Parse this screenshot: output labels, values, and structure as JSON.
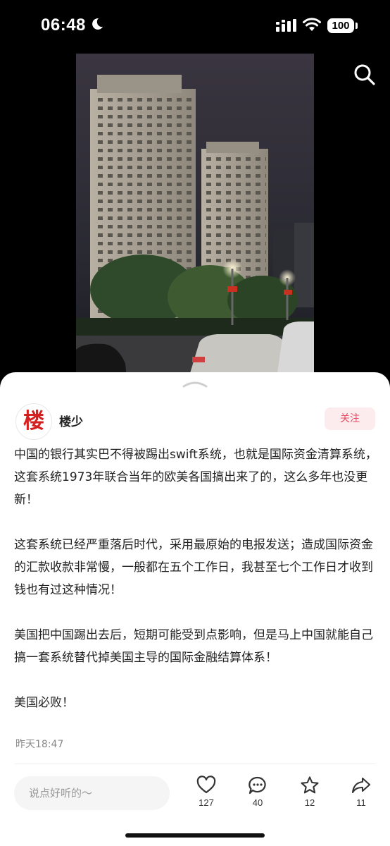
{
  "status_bar": {
    "time": "06:48",
    "battery": "100"
  },
  "post": {
    "author": {
      "avatar_char": "楼",
      "name": "楼少",
      "follow_label": "关注"
    },
    "paragraphs": [
      "中国的银行其实巴不得被踢出swift系统，也就是国际资金清算系统，这套系统1973年联合当年的欧美各国搞出来了的，这么多年也没更新！",
      "这套系统已经严重落后时代，采用最原始的电报发送；造成国际资金的汇款收款非常慢，一般都在五个工作日，我甚至七个工作日才收到钱也有过这种情况！",
      "美国把中国踢出去后，短期可能受到点影响，但是马上中国就能自己搞一套系统替代掉美国主导的国际金融结算体系！",
      "美国必败！"
    ],
    "time": "昨天18:47"
  },
  "bottom_bar": {
    "comment_placeholder": "说点好听的～",
    "likes": "127",
    "comments": "40",
    "favorites": "12",
    "shares": "11"
  },
  "colors": {
    "accent": "#e84d64",
    "follow_bg": "#fdecee",
    "avatar_red": "#d42020"
  },
  "icons": [
    "moon-icon",
    "signal-icon",
    "wifi-icon",
    "battery-icon",
    "search-icon",
    "heart-icon",
    "comment-icon",
    "star-icon",
    "share-icon"
  ]
}
